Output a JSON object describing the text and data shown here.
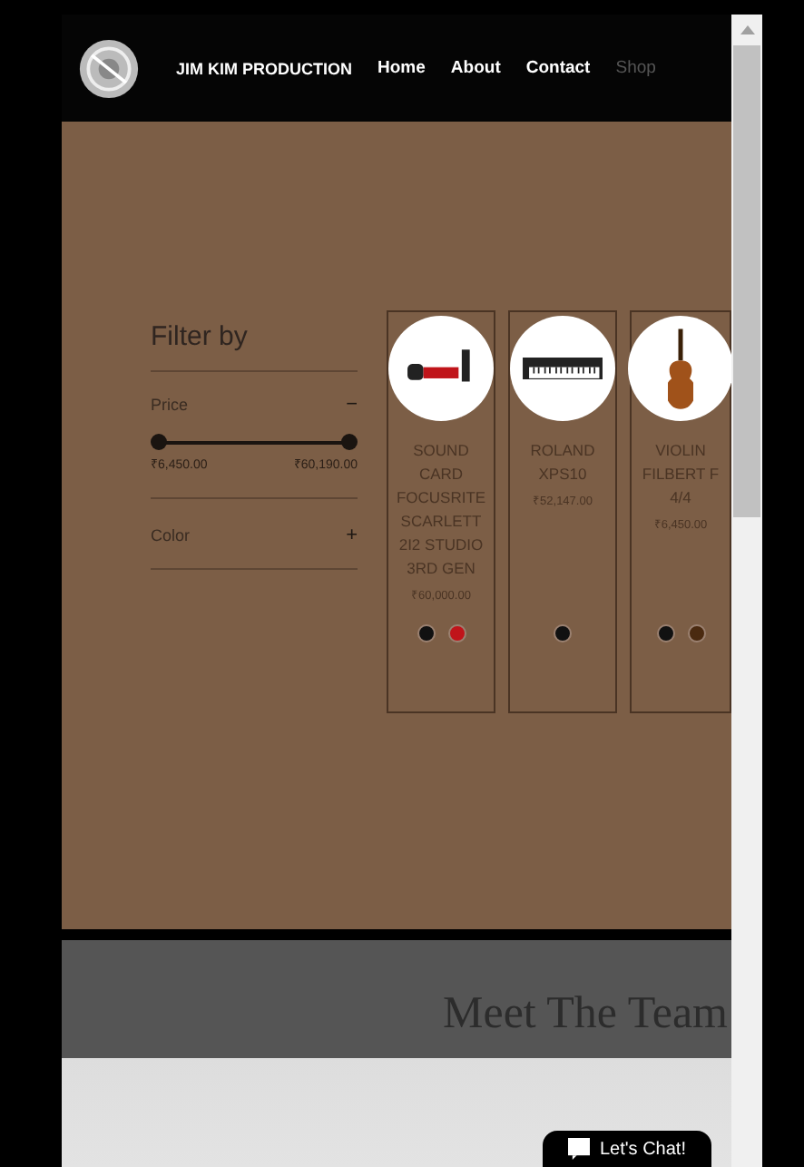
{
  "header": {
    "brand": "JIM KIM PRODUCTION",
    "nav": [
      {
        "label": "Home",
        "selected": false
      },
      {
        "label": "About",
        "selected": false
      },
      {
        "label": "Contact",
        "selected": false
      },
      {
        "label": "Shop",
        "selected": true
      }
    ]
  },
  "filter": {
    "title": "Filter by",
    "price": {
      "label": "Price",
      "toggle": "−",
      "handles": [
        {
          "level": 0
        },
        {
          "level": 1
        }
      ],
      "min": "₹6,450.00",
      "max": "₹60,190.00"
    },
    "color": {
      "label": "Color",
      "toggle": "+"
    }
  },
  "products": [
    {
      "name": "SOUND CARD FOCUSRITE SCARLETT 2I2 STUDIO 3RD GEN",
      "price": "₹60,000.00",
      "kind": "audio",
      "colors": [
        {
          "color": "#111111"
        },
        {
          "color": "#c0141a"
        }
      ]
    },
    {
      "name": "ROLAND XPS10",
      "price": "₹52,147.00",
      "kind": "keyboard",
      "colors": [
        {
          "color": "#111111"
        }
      ]
    },
    {
      "name": "VIOLIN FILBERT F 4/4",
      "price": "₹6,450.00",
      "kind": "violin",
      "colors": [
        {
          "color": "#111111"
        },
        {
          "color": "#4a2a10"
        }
      ]
    }
  ],
  "team": {
    "title": "Meet The Team"
  },
  "chat": {
    "label": "Let's Chat!"
  }
}
